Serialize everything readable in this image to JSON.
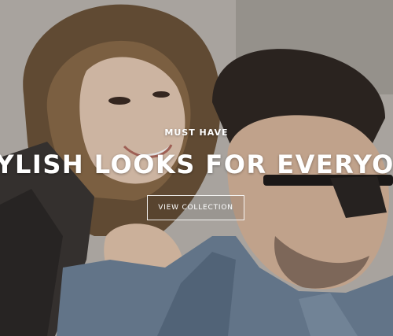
{
  "hero": {
    "eyebrow": "MUST HAVE",
    "headline": "STYLISH LOOKS FOR EVERYONE",
    "cta_label": "VIEW COLLECTION"
  },
  "colors": {
    "text": "#ffffff",
    "button_border": "#ffffff"
  }
}
